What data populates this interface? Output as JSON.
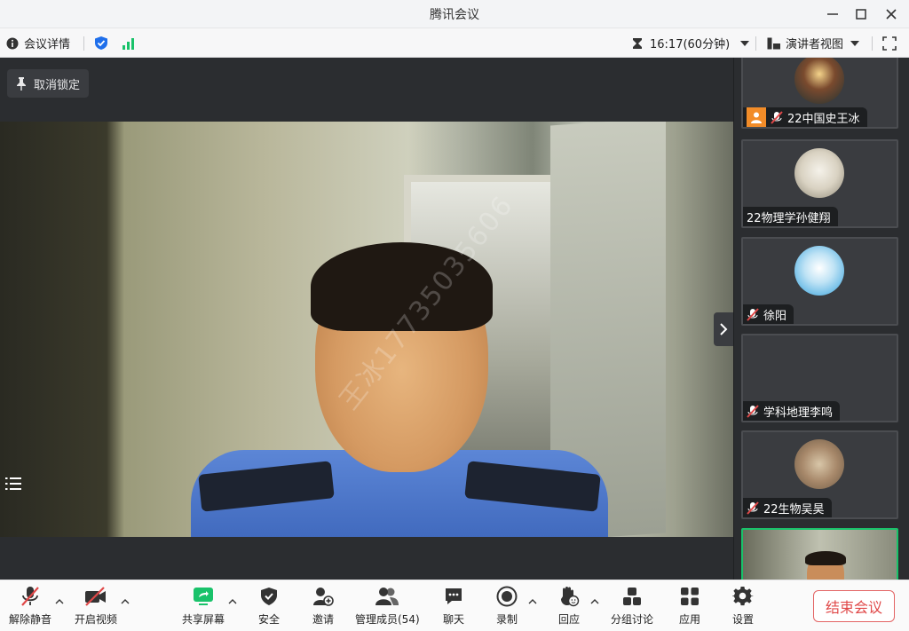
{
  "window": {
    "title": "腾讯会议"
  },
  "infobar": {
    "meeting_details": "会议详情",
    "timer": "16:17(60分钟)",
    "view_mode": "演讲者视图"
  },
  "stage": {
    "pin_label": "取消锁定",
    "watermark": "王冰17735035606"
  },
  "participants": [
    {
      "name": "22中国史王冰",
      "host": true,
      "muted": true
    },
    {
      "name": "22物理学孙健翔",
      "host": false,
      "muted": false
    },
    {
      "name": "徐阳",
      "host": false,
      "muted": true
    },
    {
      "name": "学科地理李鸣",
      "host": false,
      "muted": true
    },
    {
      "name": "22生物吴昊",
      "host": false,
      "muted": true
    },
    {
      "name": "",
      "host": false,
      "muted": false
    }
  ],
  "toolbar": {
    "unmute": "解除静音",
    "video": "开启视频",
    "share": "共享屏幕",
    "security": "安全",
    "invite": "邀请",
    "members": "管理成员(54)",
    "chat": "聊天",
    "record": "录制",
    "reaction": "回应",
    "breakout": "分组讨论",
    "apps": "应用",
    "settings": "设置",
    "end": "结束会议"
  },
  "colors": {
    "accent_green": "#19c26a",
    "end_red": "#e04848",
    "shield_blue": "#1f6feb"
  }
}
